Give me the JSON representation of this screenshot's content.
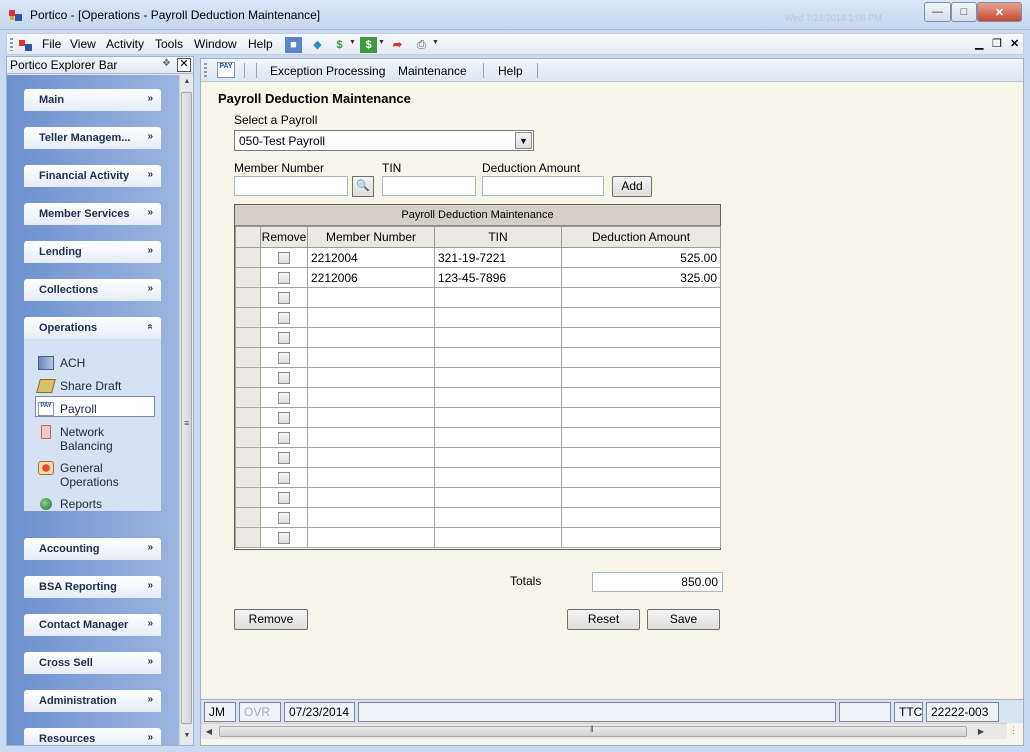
{
  "window": {
    "title": "Portico - [Operations - Payroll Deduction Maintenance]",
    "faint_info": "Wed 7/23/2014 1:06 PM"
  },
  "menubar": {
    "items": [
      "File",
      "View",
      "Activity",
      "Tools",
      "Window",
      "Help"
    ]
  },
  "explorer": {
    "title": "Portico Explorer Bar",
    "groups": [
      {
        "label": "Main",
        "expanded": false
      },
      {
        "label": "Teller Managem...",
        "expanded": false
      },
      {
        "label": "Financial Activity",
        "expanded": false
      },
      {
        "label": "Member Services",
        "expanded": false
      },
      {
        "label": "Lending",
        "expanded": false
      },
      {
        "label": "Collections",
        "expanded": false
      },
      {
        "label": "Operations",
        "expanded": true
      },
      {
        "label": "Accounting",
        "expanded": false
      },
      {
        "label": "BSA Reporting",
        "expanded": false
      },
      {
        "label": "Contact Manager",
        "expanded": false
      },
      {
        "label": "Cross Sell",
        "expanded": false
      },
      {
        "label": "Administration",
        "expanded": false
      },
      {
        "label": "Resources",
        "expanded": false
      }
    ],
    "operations_items": [
      {
        "label": "ACH",
        "icon": "ach-icon"
      },
      {
        "label": "Share Draft",
        "icon": "share-draft-icon"
      },
      {
        "label": "Payroll",
        "icon": "payroll-icon",
        "selected": true
      },
      {
        "label": "Network\nBalancing",
        "line1": "Network",
        "line2": "Balancing",
        "icon": "network-balancing-icon"
      },
      {
        "label": "General\nOperations",
        "line1": "General",
        "line2": "Operations",
        "icon": "general-operations-icon"
      },
      {
        "label": "Reports",
        "icon": "reports-icon"
      }
    ]
  },
  "main_toolbar": {
    "pay_icon_text": "PAY",
    "items": [
      "Exception Processing",
      "Maintenance",
      "Help"
    ]
  },
  "form": {
    "title": "Payroll Deduction Maintenance",
    "select_label": "Select a Payroll",
    "select_value": "050-Test Payroll",
    "member_number_label": "Member Number",
    "member_number_value": "",
    "tin_label": "TIN",
    "tin_value": "",
    "deduction_amount_label": "Deduction Amount",
    "deduction_amount_value": "",
    "add_label": "Add"
  },
  "grid": {
    "caption": "Payroll Deduction Maintenance",
    "columns": [
      "Remove",
      "Member Number",
      "TIN",
      "Deduction Amount"
    ],
    "rows": [
      {
        "member": "2212004",
        "tin": "321-19-7221",
        "amount": "525.00"
      },
      {
        "member": "2212006",
        "tin": "123-45-7896",
        "amount": "325.00"
      },
      {
        "member": "",
        "tin": "",
        "amount": ""
      },
      {
        "member": "",
        "tin": "",
        "amount": ""
      },
      {
        "member": "",
        "tin": "",
        "amount": ""
      },
      {
        "member": "",
        "tin": "",
        "amount": ""
      },
      {
        "member": "",
        "tin": "",
        "amount": ""
      },
      {
        "member": "",
        "tin": "",
        "amount": ""
      },
      {
        "member": "",
        "tin": "",
        "amount": ""
      },
      {
        "member": "",
        "tin": "",
        "amount": ""
      },
      {
        "member": "",
        "tin": "",
        "amount": ""
      },
      {
        "member": "",
        "tin": "",
        "amount": ""
      },
      {
        "member": "",
        "tin": "",
        "amount": ""
      },
      {
        "member": "",
        "tin": "",
        "amount": ""
      },
      {
        "member": "",
        "tin": "",
        "amount": ""
      }
    ]
  },
  "totals": {
    "label": "Totals",
    "value": "850.00"
  },
  "buttons": {
    "remove": "Remove",
    "reset": "Reset",
    "save": "Save"
  },
  "statusbar": {
    "user": "JM",
    "ovr": "OVR",
    "date": "07/23/2014",
    "ttc": "TTC",
    "id": "22222-003"
  },
  "colors": {
    "explorer_gradient": "#6b8fcd",
    "form_background": "#f7f4ea",
    "grid_header": "#d4d0c8"
  }
}
